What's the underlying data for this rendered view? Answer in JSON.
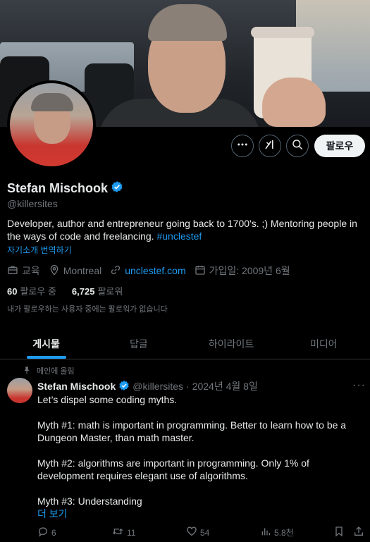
{
  "profile": {
    "name": "Stefan Mischook",
    "handle": "@killersites",
    "bio_text": "Developer, author and entrepreneur going back to 1700's. ;) Mentoring people in the ways of code and freelancing. ",
    "bio_hashtag": "#unclestef",
    "translate_label": "자기소개 번역하기",
    "category": "교육",
    "location": "Montreal",
    "website": "unclestef.com",
    "joined": "가입일: 2009년 6월",
    "following_count": "60",
    "following_label": "팔로우 중",
    "followers_count": "6,725",
    "followers_label": "팔로워",
    "no_mutual_text": "내가 팔로우하는 사용자 중에는 팔로워가 없습니다"
  },
  "actions": {
    "follow_label": "팔로우",
    "more_icon": "more-horizontal-icon",
    "grok_icon": "grok-icon",
    "search_icon": "search-icon"
  },
  "tabs": [
    {
      "label": "게시물",
      "active": true
    },
    {
      "label": "답글",
      "active": false
    },
    {
      "label": "하이라이트",
      "active": false
    },
    {
      "label": "미디어",
      "active": false
    }
  ],
  "post": {
    "pinned_label": "메인에 올림",
    "author_name": "Stefan Mischook",
    "author_handle": "@killersites",
    "date": "2024년 4월 8일",
    "lines": [
      "Let’s dispel some coding myths.",
      "",
      "Myth #1: math is important in programming. Better to learn how to be a",
      "Dungeon Master, than math master.",
      "",
      "Myth #2: algorithms are important in programming. Only 1% of",
      "development requires elegant use of algorithms.",
      "",
      "Myth #3: Understanding"
    ],
    "show_more_label": "더 보기",
    "stats": {
      "replies": "6",
      "reposts": "11",
      "likes": "54",
      "views": "5.8천"
    }
  },
  "colors": {
    "accent": "#1d9bf0",
    "background": "#000000",
    "text_primary": "#e7e9ea",
    "text_secondary": "#71767b"
  }
}
